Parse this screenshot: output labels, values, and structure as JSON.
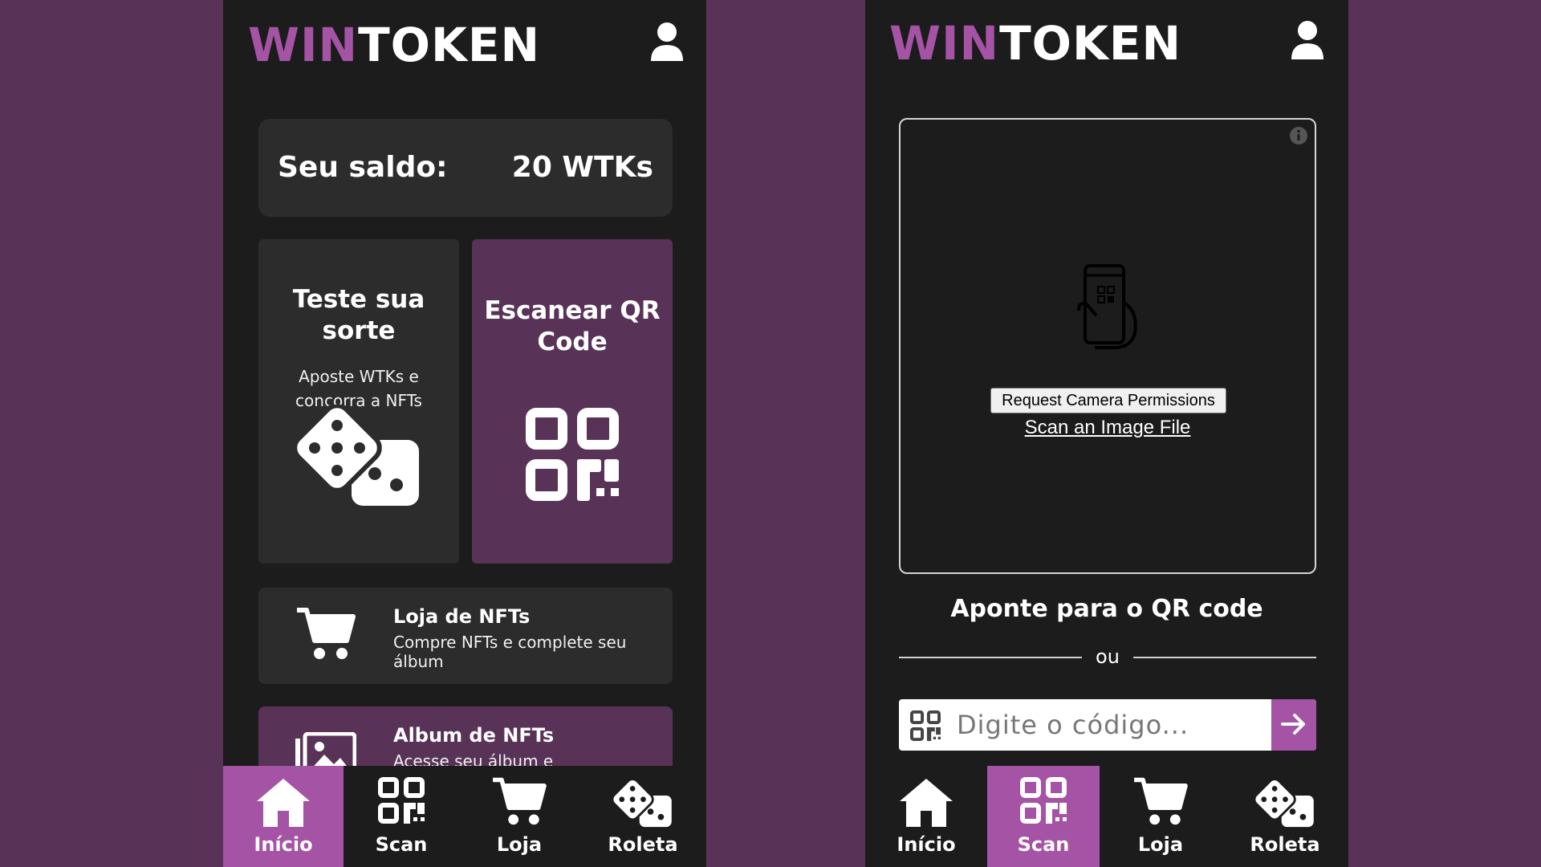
{
  "brand": {
    "win": "WIN",
    "token": "TOKEN",
    "accent": "#a553a4",
    "dark_purple": "#583357"
  },
  "home": {
    "balance": {
      "label": "Seu saldo:",
      "value": "20 WTKs"
    },
    "luck_tile": {
      "title": "Teste sua sorte",
      "subtitle_line1": "Aposte WTKs e",
      "subtitle_line2": "concorra a NFTs",
      "icon": "dice-icon"
    },
    "scan_tile": {
      "title_line1": "Escanear QR",
      "title_line2": "Code",
      "icon": "qr-code-icon"
    },
    "shop_card": {
      "title": "Loja de NFTs",
      "subtitle": "Compre NFTs e complete seu álbum",
      "icon": "cart-icon"
    },
    "album_card": {
      "title": "Album de NFTs",
      "subtitle": "Acesse seu álbum e acompanhe",
      "icon": "image-icon"
    }
  },
  "scan_page": {
    "request_permissions": "Request Camera Permissions",
    "scan_image_file": "Scan an Image File",
    "point_text": "Aponte para o QR code",
    "or_text": "ou",
    "code_placeholder": "Digite o código..."
  },
  "nav": {
    "items": [
      {
        "label": "Início",
        "icon": "home-icon"
      },
      {
        "label": "Scan",
        "icon": "qr-code-icon"
      },
      {
        "label": "Loja",
        "icon": "cart-icon"
      },
      {
        "label": "Roleta",
        "icon": "dice-icon"
      }
    ],
    "left_active": "Início",
    "right_active": "Scan"
  }
}
